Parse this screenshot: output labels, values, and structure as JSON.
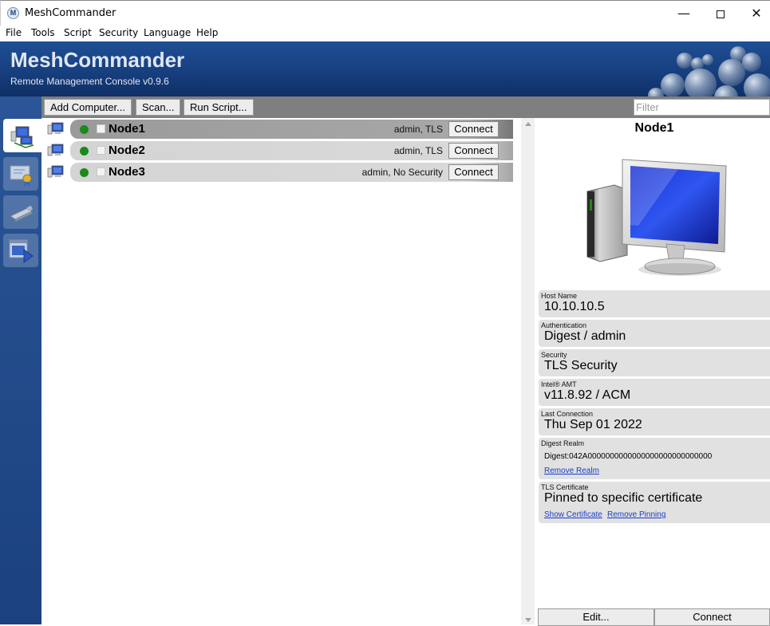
{
  "window": {
    "title": "MeshCommander",
    "icon_letter": "M",
    "minimize": "—",
    "close": "✕"
  },
  "menu": [
    "File",
    "Tools",
    "Script",
    "Security",
    "Language",
    "Help"
  ],
  "banner": {
    "title": "MeshCommander",
    "subtitle": "Remote Management Console v0.9.6"
  },
  "sidebar": {
    "tabs": [
      "computers-tab",
      "certificates-tab",
      "usb-tab",
      "deploy-tab"
    ]
  },
  "toolbar": {
    "add_computer": "Add Computer...",
    "scan": "Scan...",
    "run_script": "Run Script...",
    "filter_placeholder": "Filter"
  },
  "nodes": [
    {
      "name": "Node1",
      "security": "admin, TLS",
      "connect": "Connect",
      "status_color": "#1b8a1b"
    },
    {
      "name": "Node2",
      "security": "admin, TLS",
      "connect": "Connect",
      "status_color": "#1b8a1b"
    },
    {
      "name": "Node3",
      "security": "admin, No Security",
      "connect": "Connect",
      "status_color": "#1b8a1b"
    }
  ],
  "details": {
    "title": "Node1",
    "host_label": "Host Name",
    "host_value": "10.10.10.5",
    "auth_label": "Authentication",
    "auth_value": "Digest / admin",
    "security_label": "Security",
    "security_value": "TLS Security",
    "amt_label": "Intel® AMT",
    "amt_value": "v11.8.92 / ACM",
    "last_label": "Last Connection",
    "last_value": "Thu Sep 01 2022",
    "realm_label": "Digest Realm",
    "realm_value": "Digest:042A0000000000000000000000000000",
    "remove_realm": "Remove Realm",
    "tls_label": "TLS Certificate",
    "tls_value": "Pinned to specific certificate",
    "show_cert": "Show Certificate",
    "remove_pinning": "Remove Pinning",
    "edit_button": "Edit...",
    "connect_button": "Connect"
  }
}
